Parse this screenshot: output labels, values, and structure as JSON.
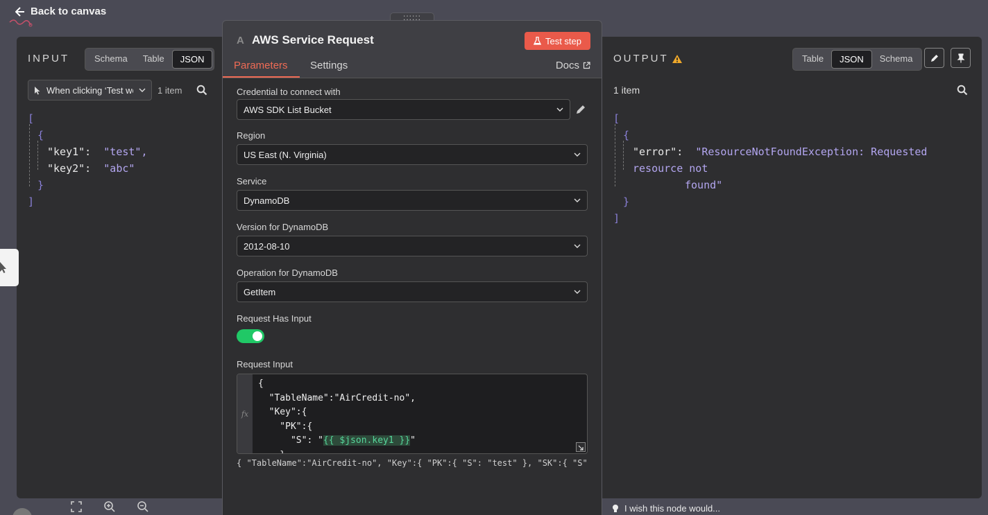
{
  "top": {
    "back_label": "Back to canvas"
  },
  "input": {
    "title": "INPUT",
    "view_tabs": [
      "Schema",
      "Table",
      "JSON"
    ],
    "active_tab": "JSON",
    "node_select": "When clicking ‘Test wo",
    "item_count": "1 item",
    "json": {
      "open": "[",
      "obj_open": "{",
      "key1": "\"key1\":",
      "val1": "\"test\",",
      "key2": "\"key2\":",
      "val2": "\"abc\"",
      "obj_close": "}",
      "close": "]"
    }
  },
  "node": {
    "handle": "::::::",
    "icon": "A",
    "title": "AWS Service Request",
    "test_step": "Test step",
    "tabs": {
      "parameters": "Parameters",
      "settings": "Settings",
      "docs": "Docs"
    },
    "fields": {
      "credential_label": "Credential to connect with",
      "credential_value": "AWS SDK List Bucket",
      "region_label": "Region",
      "region_value": "US East (N. Virginia)",
      "service_label": "Service",
      "service_value": "DynamoDB",
      "version_label": "Version for DynamoDB",
      "version_value": "2012-08-10",
      "operation_label": "Operation for DynamoDB",
      "operation_value": "GetItem",
      "has_input_label": "Request Has Input",
      "has_input_on": true,
      "request_input_label": "Request Input"
    },
    "code": {
      "fx": "fx",
      "l1": "{",
      "l2": "  \"TableName\":\"AirCredit-no\",",
      "l3": "  \"Key\":{",
      "l4": "    \"PK\":{",
      "l5a": "      \"S\": \"",
      "l5b": "{{ $json.key1 }}",
      "l5c": "\"",
      "l6": "    },"
    },
    "preview": "{   \"TableName\":\"AirCredit-no\",   \"Key\":{     \"PK\":{       \"S\": \"test\"     },     \"SK\":{       \"S\": \"abc\"   ..."
  },
  "output": {
    "title": "OUTPUT",
    "warning_icon": "warning-icon",
    "view_tabs": [
      "Table",
      "JSON",
      "Schema"
    ],
    "active_tab": "JSON",
    "item_count": "1 item",
    "json": {
      "open": "[",
      "obj_open": "{",
      "key": "\"error\":",
      "val_line1": "\"ResourceNotFoundException: Requested resource not",
      "val_line2": "found\"",
      "obj_close": "}",
      "close": "]"
    }
  },
  "bottom": {
    "wish": "I wish this node would..."
  },
  "colors": {
    "accent": "#ef6b55",
    "toggle_on": "#20c866",
    "json_string": "#b3a6f0"
  }
}
